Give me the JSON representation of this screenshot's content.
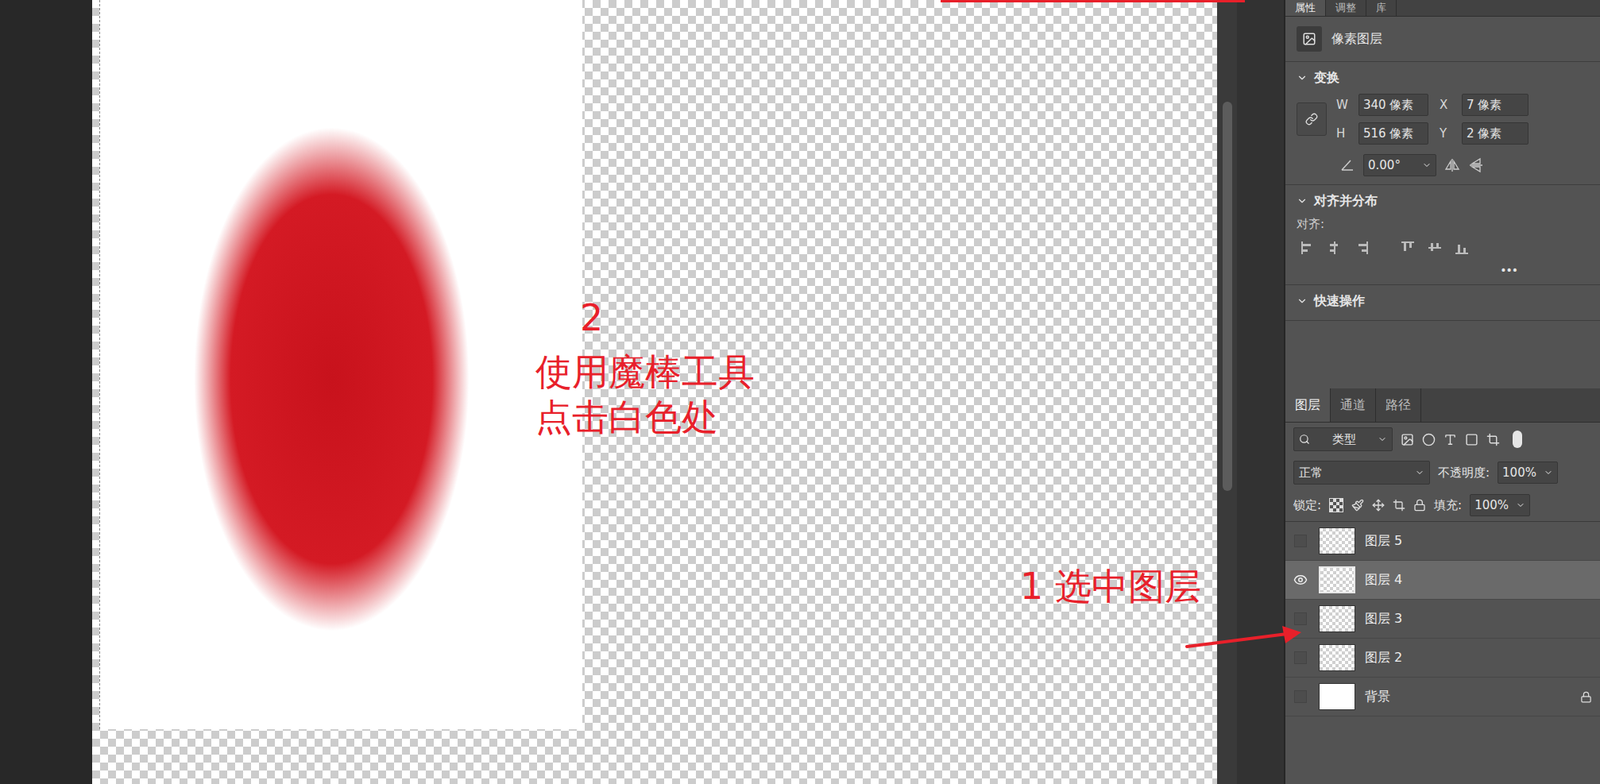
{
  "annotations": {
    "step_two": {
      "number": "2",
      "lines": [
        "使用魔棒工具",
        "点击白色处"
      ]
    },
    "step_one": {
      "text": "1 选中图层"
    }
  },
  "properties": {
    "tabs": [
      {
        "label": "属性",
        "selected": true
      },
      {
        "label": "调整",
        "selected": false
      },
      {
        "label": "库",
        "selected": false
      }
    ],
    "layer_kind": "像素图层",
    "transform": {
      "title": "变换",
      "expanded": true,
      "fields": [
        {
          "label": "W",
          "value": "340 像素"
        },
        {
          "label": "X",
          "value": "7 像素"
        },
        {
          "label": "H",
          "value": "516 像素"
        },
        {
          "label": "Y",
          "value": "2 像素"
        }
      ],
      "angle": "0.00°"
    },
    "align": {
      "title": "对齐并分布",
      "expanded": true,
      "label": "对齐:",
      "more": "•••"
    },
    "quick_actions": {
      "title": "快速操作",
      "expanded": true
    }
  },
  "layers_panel": {
    "tabs": [
      {
        "label": "图层",
        "selected": true
      },
      {
        "label": "通道",
        "selected": false
      },
      {
        "label": "路径",
        "selected": false
      }
    ],
    "filter": "类型",
    "blend_mode": "正常",
    "opacity_label": "不透明度:",
    "opacity": "100%",
    "lock_label": "锁定:",
    "fill_label": "填充:",
    "fill": "100%",
    "layers": [
      {
        "name": "图层 5",
        "kind": "pixel",
        "visible": false,
        "selected": false,
        "locked": false
      },
      {
        "name": "图层 4",
        "kind": "pixel",
        "visible": true,
        "selected": true,
        "locked": false
      },
      {
        "name": "图层 3",
        "kind": "pixel",
        "visible": false,
        "selected": false,
        "locked": false
      },
      {
        "name": "图层 2",
        "kind": "pixel",
        "visible": false,
        "selected": false,
        "locked": false
      },
      {
        "name": "背景",
        "kind": "background",
        "visible": false,
        "selected": false,
        "locked": true
      }
    ]
  }
}
